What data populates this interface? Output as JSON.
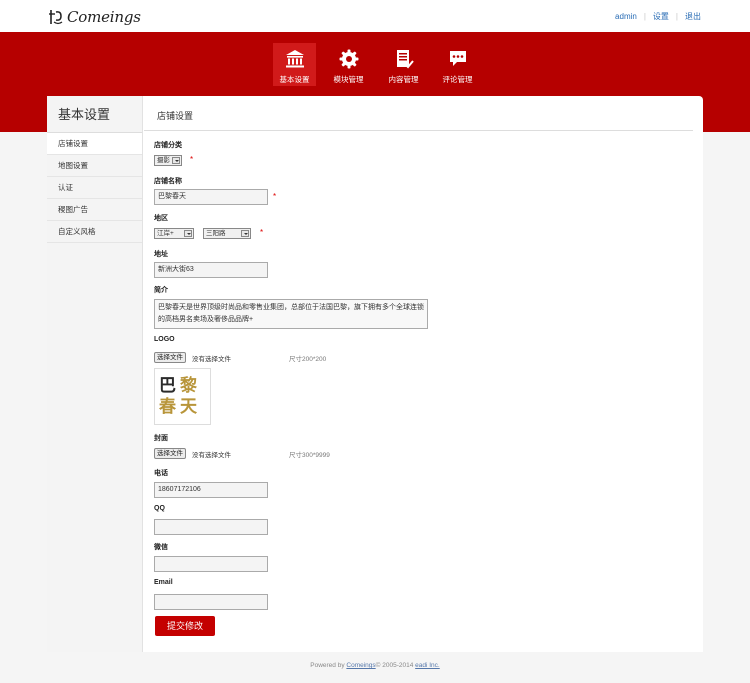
{
  "header": {
    "brand": "Comeings",
    "links": {
      "admin": "admin",
      "settings": "设置",
      "logout": "退出"
    }
  },
  "nav": [
    {
      "label": "基本设置",
      "icon": "bank-icon",
      "active": true
    },
    {
      "label": "模块管理",
      "icon": "gear-icon",
      "active": false
    },
    {
      "label": "内容管理",
      "icon": "document-check-icon",
      "active": false
    },
    {
      "label": "评论管理",
      "icon": "chat-bubble-icon",
      "active": false
    }
  ],
  "sidebar": {
    "title": "基本设置",
    "items": [
      {
        "label": "店铺设置",
        "active": true
      },
      {
        "label": "地图设置",
        "active": false
      },
      {
        "label": "认证",
        "active": false
      },
      {
        "label": "稷图广告",
        "active": false
      },
      {
        "label": "自定义风格",
        "active": false
      }
    ]
  },
  "main": {
    "title": "店铺设置",
    "form": {
      "category": {
        "label": "店铺分类",
        "value": "摄影"
      },
      "name": {
        "label": "店铺名称",
        "value": "巴黎春天"
      },
      "region": {
        "label": "地区",
        "province": "江岸+",
        "district": "三阳路"
      },
      "address": {
        "label": "地址",
        "value": "新洲大街63"
      },
      "intro": {
        "label": "简介",
        "value": "巴黎春天是世界顶级时尚品和零售业集团，总部位于法国巴黎，旗下拥有多个全球连锁的高档男名卖场及奢侈品品牌+"
      },
      "logo": {
        "label": "LOGO",
        "button": "选择文件",
        "status": "没有选择文件",
        "hint": "尺寸200*200",
        "preview_text": [
          "巴黎",
          "春天"
        ]
      },
      "cover": {
        "label": "封面",
        "button": "选择文件",
        "status": "没有选择文件",
        "hint": "尺寸300*9999"
      },
      "phone": {
        "label": "电话",
        "value": "18607172106"
      },
      "qq": {
        "label": "QQ",
        "value": ""
      },
      "wechat": {
        "label": "微信",
        "value": ""
      },
      "email": {
        "label": "Email",
        "value": ""
      },
      "required_mark": "*",
      "submit": "提交修改"
    }
  },
  "footer": {
    "prefix": "Powered by ",
    "brand": "Comeings",
    "middle": "© 2005-2014 ",
    "company": "eadi Inc."
  },
  "colors": {
    "brand_red": "#b60000",
    "active_nav": "#d11a1a",
    "button_red": "#c40000",
    "link_blue": "#2a6db5"
  }
}
